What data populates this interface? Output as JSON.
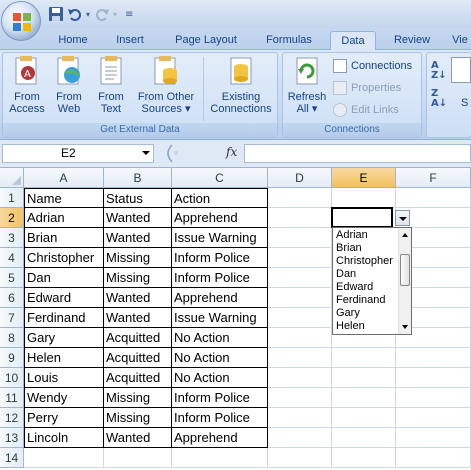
{
  "quick_access": {
    "icons": [
      "save-icon",
      "undo-icon",
      "redo-icon",
      "customize-qat-icon"
    ]
  },
  "tabs": [
    {
      "label": "Home",
      "active": false
    },
    {
      "label": "Insert",
      "active": false
    },
    {
      "label": "Page Layout",
      "active": false
    },
    {
      "label": "Formulas",
      "active": false
    },
    {
      "label": "Data",
      "active": true
    },
    {
      "label": "Review",
      "active": false
    },
    {
      "label": "Vie",
      "active": false
    }
  ],
  "ribbon": {
    "get_external_data": {
      "label": "Get External Data",
      "from_access": {
        "line1": "From",
        "line2": "Access"
      },
      "from_web": {
        "line1": "From",
        "line2": "Web"
      },
      "from_text": {
        "line1": "From",
        "line2": "Text"
      },
      "from_other": {
        "line1": "From Other",
        "line2": "Sources ▾"
      },
      "existing": {
        "line1": "Existing",
        "line2": "Connections"
      }
    },
    "connections": {
      "label": "Connections",
      "refresh": {
        "line1": "Refresh",
        "line2": "All ▾"
      },
      "connections_btn": "Connections",
      "properties_btn": "Properties",
      "edit_links_btn": "Edit Links"
    },
    "sort_partial": "S"
  },
  "formula_bar": {
    "name_box": "E2",
    "fx": "fx",
    "formula": ""
  },
  "columns": [
    "A",
    "B",
    "C",
    "D",
    "E",
    "F"
  ],
  "selected_column": "E",
  "selected_row": "2",
  "rows": [
    "1",
    "2",
    "3",
    "4",
    "5",
    "6",
    "7",
    "8",
    "9",
    "10",
    "11",
    "12",
    "13",
    "14"
  ],
  "table": [
    [
      "Name",
      "Status",
      "Action"
    ],
    [
      "Adrian",
      "Wanted",
      "Apprehend"
    ],
    [
      "Brian",
      "Wanted",
      "Issue Warning"
    ],
    [
      "Christopher",
      "Missing",
      "Inform Police"
    ],
    [
      "Dan",
      "Missing",
      "Inform Police"
    ],
    [
      "Edward",
      "Wanted",
      "Apprehend"
    ],
    [
      "Ferdinand",
      "Wanted",
      "Issue Warning"
    ],
    [
      "Gary",
      "Acquitted",
      "No Action"
    ],
    [
      "Helen",
      "Acquitted",
      "No Action"
    ],
    [
      "Louis",
      "Acquitted",
      "No Action"
    ],
    [
      "Wendy",
      "Missing",
      "Inform Police"
    ],
    [
      "Perry",
      "Missing",
      "Inform Police"
    ],
    [
      "Lincoln",
      "Wanted",
      "Apprehend"
    ]
  ],
  "dropdown": {
    "items": [
      "Adrian",
      "Brian",
      "Christopher",
      "Dan",
      "Edward",
      "Ferdinand",
      "Gary",
      "Helen"
    ]
  },
  "colors": {
    "ribbon_text": "#15428b",
    "selected_header": "#f1c15f",
    "grid_line": "#d0d7e5"
  }
}
